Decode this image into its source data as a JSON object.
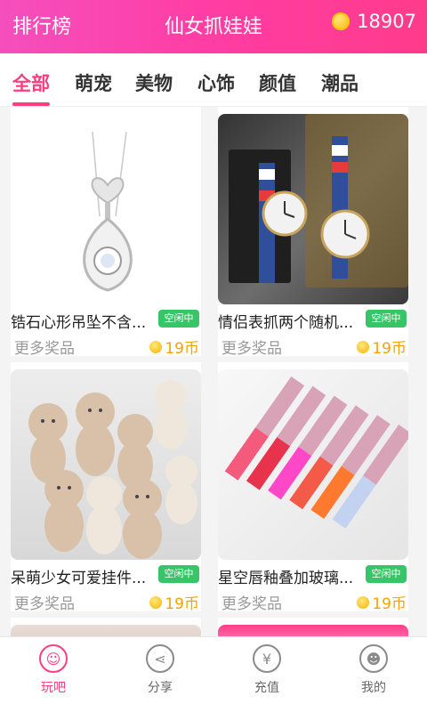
{
  "header": {
    "left_label": "排行榜",
    "title": "仙女抓娃娃",
    "coins": "18907"
  },
  "tabs": [
    {
      "label": "全部"
    },
    {
      "label": "萌宠"
    },
    {
      "label": "美物"
    },
    {
      "label": "心饰"
    },
    {
      "label": "颜值"
    },
    {
      "label": "潮品"
    }
  ],
  "products": [
    {
      "name": "锆石心形吊坠不含...",
      "status": "空闲中",
      "more": "更多奖品",
      "price": "19币",
      "image": "pendant"
    },
    {
      "name": "情侣表抓两个随机...",
      "status": "空闲中",
      "more": "更多奖品",
      "price": "19币",
      "image": "watches"
    },
    {
      "name": "呆萌少女可爱挂件...",
      "status": "空闲中",
      "more": "更多奖品",
      "price": "19币",
      "image": "teddy-bears"
    },
    {
      "name": "星空唇釉叠加玻璃...",
      "status": "空闲中",
      "more": "更多奖品",
      "price": "19币",
      "image": "lip-gloss"
    }
  ],
  "bottom_nav": [
    {
      "label": "玩吧",
      "icon": "smile-icon"
    },
    {
      "label": "分享",
      "icon": "share-icon"
    },
    {
      "label": "充值",
      "icon": "yen-icon"
    },
    {
      "label": "我的",
      "icon": "profile-icon"
    }
  ],
  "colors": {
    "accent": "#ff3d7f",
    "status_green": "#37c567",
    "coin": "#f5a300"
  }
}
